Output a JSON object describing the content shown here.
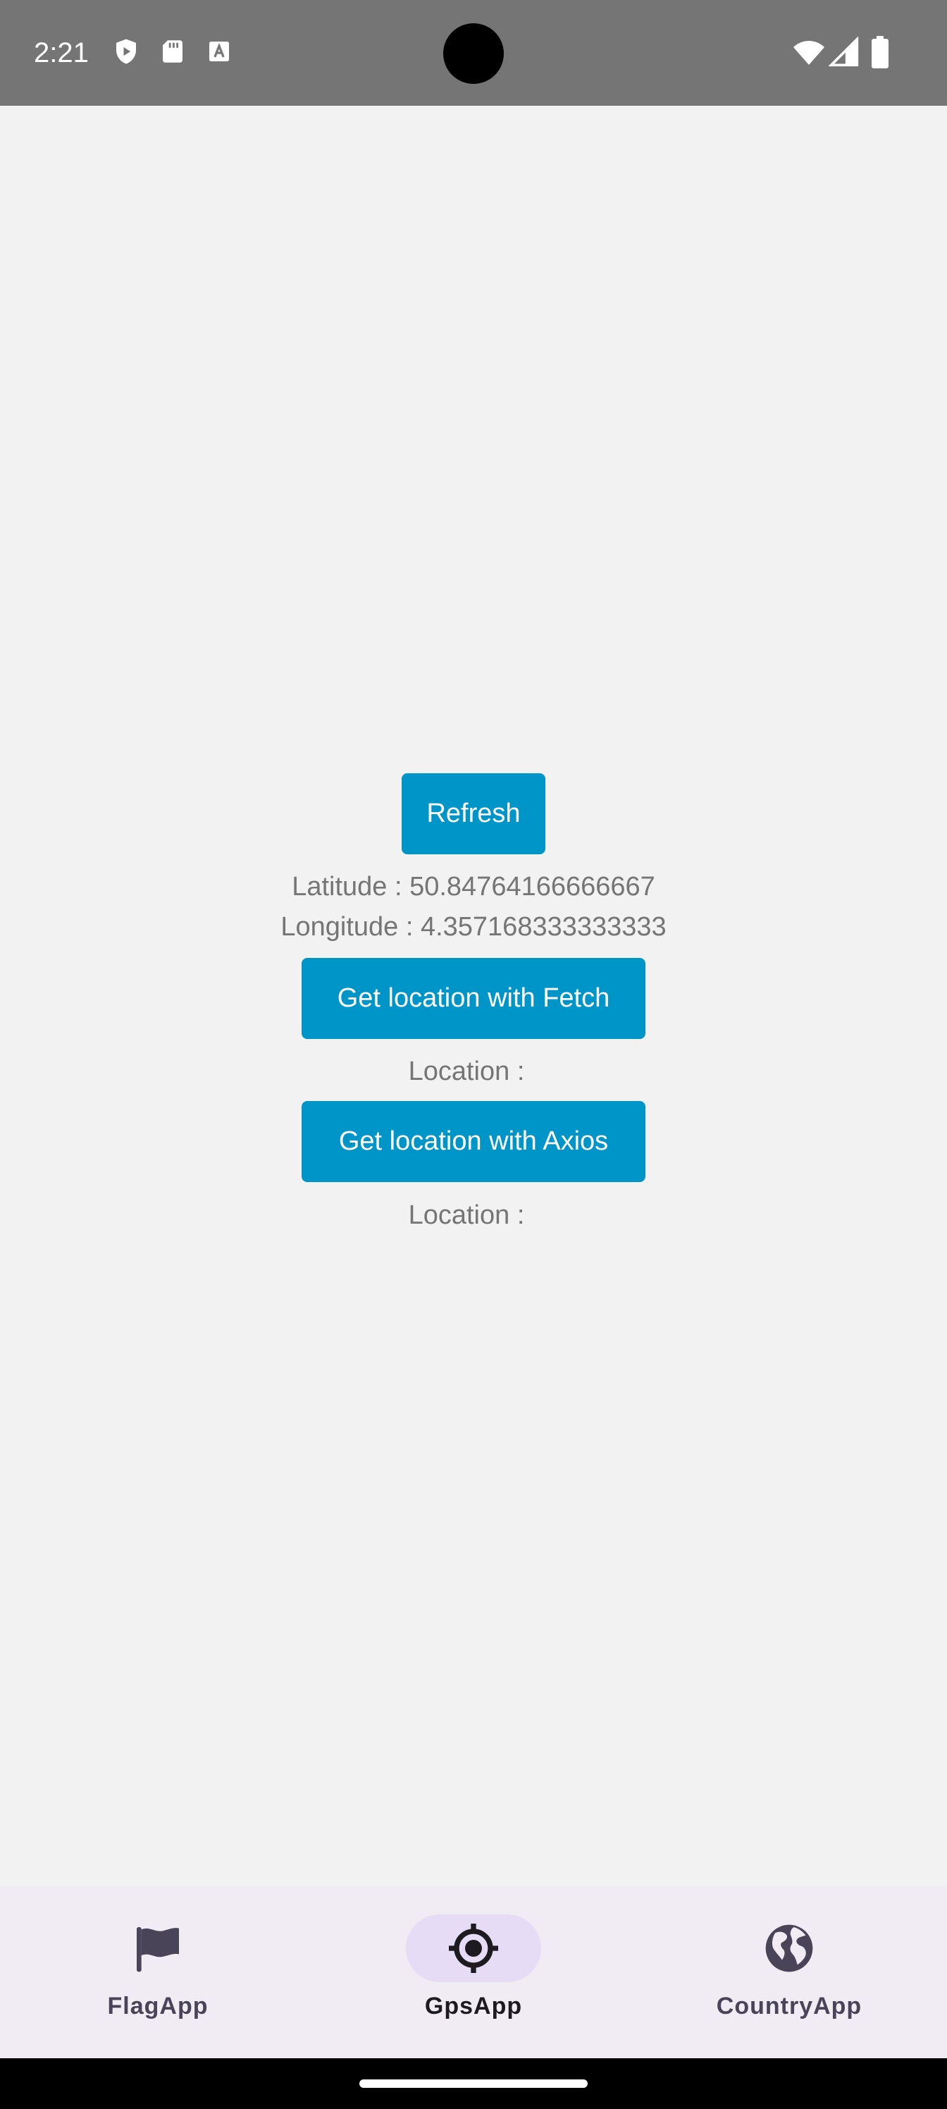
{
  "status_bar": {
    "time": "2:21",
    "icons_left": [
      "shield-play-icon",
      "sd-card-icon",
      "text-a-icon"
    ],
    "icons_right": [
      "wifi-icon",
      "cell-signal-icon",
      "battery-icon"
    ]
  },
  "main": {
    "refresh_label": "Refresh",
    "latitude_text": "Latitude : 50.84764166666667",
    "longitude_text": "Longitude : 4.357168333333333",
    "fetch_button_label": "Get location with Fetch",
    "fetch_location_text": "Location :",
    "axios_button_label": "Get location with Axios",
    "axios_location_text": "Location :"
  },
  "bottom_nav": {
    "items": [
      {
        "label": "FlagApp",
        "icon": "flag-icon",
        "active": false
      },
      {
        "label": "GpsApp",
        "icon": "gps-target-icon",
        "active": true
      },
      {
        "label": "CountryApp",
        "icon": "globe-icon",
        "active": false
      }
    ]
  },
  "colors": {
    "background": "#f2f2f2",
    "status_bar": "#757575",
    "button": "#0095c9",
    "text": "#757575",
    "nav_background": "#f1ecf3",
    "nav_active_indicator": "#e7dcf5"
  }
}
